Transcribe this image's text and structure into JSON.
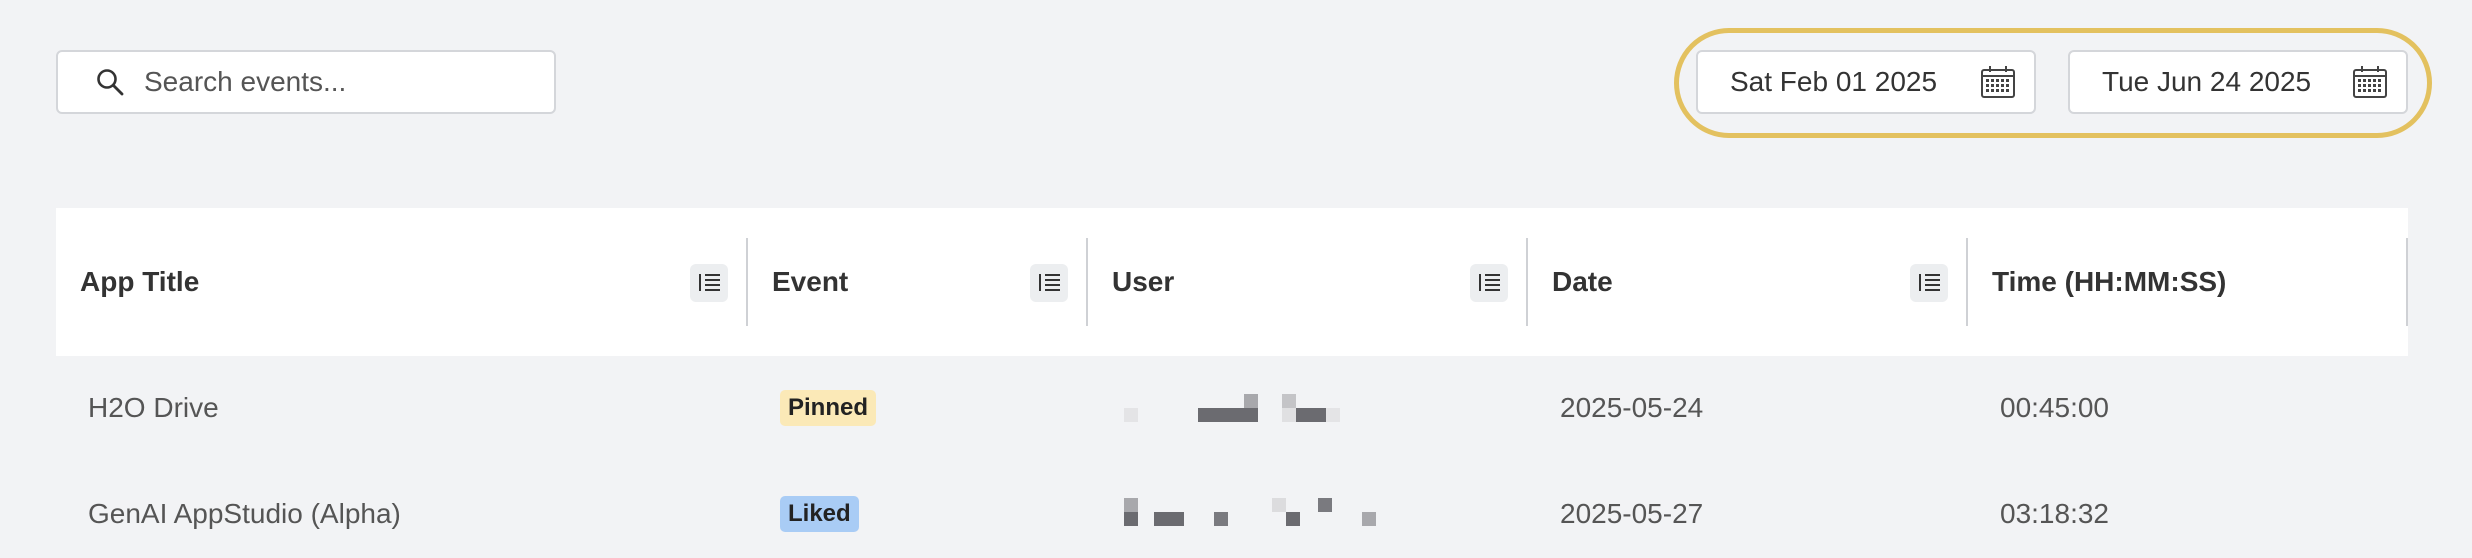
{
  "search": {
    "placeholder": "Search events..."
  },
  "date_range": {
    "start": "Sat Feb 01 2025",
    "end": "Tue Jun 24 2025"
  },
  "table": {
    "columns": [
      "App Title",
      "Event",
      "User",
      "Date",
      "Time (HH:MM:SS)"
    ],
    "rows": [
      {
        "app_title": "H2O Drive",
        "event": "Pinned",
        "user": "",
        "date": "2025-05-24",
        "time": "00:45:00"
      },
      {
        "app_title": "GenAI AppStudio (Alpha)",
        "event": "Liked",
        "user": "",
        "date": "2025-05-27",
        "time": "03:18:32"
      }
    ]
  },
  "colors": {
    "highlight_ring": "#e3c15f",
    "badge_pinned": "#fbe9b7",
    "badge_liked": "#a9ccf5",
    "background": "#f2f3f5"
  },
  "icons": {
    "search": "search-icon",
    "calendar": "calendar-icon",
    "column_menu": "column-menu-icon"
  }
}
